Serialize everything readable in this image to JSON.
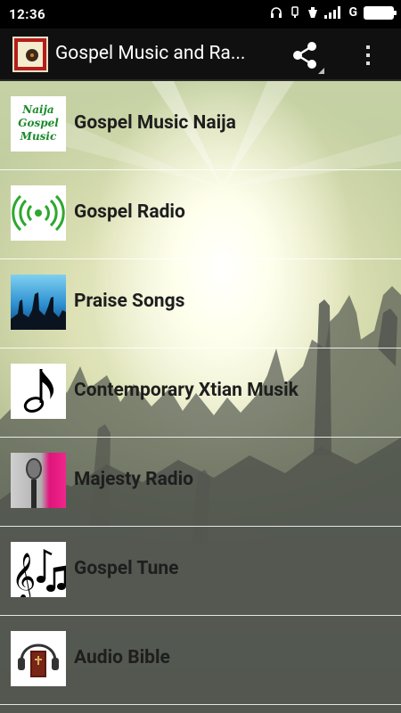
{
  "status_bar": {
    "time": "12:36",
    "network": "G"
  },
  "action_bar": {
    "title": "Gospel Music and Ra...",
    "share_icon": "share-icon",
    "overflow_icon": "overflow-menu-icon"
  },
  "list": {
    "items": [
      {
        "label": "Gospel Music Naija",
        "icon": "naija-gospel-music-logo"
      },
      {
        "label": "Gospel Radio",
        "icon": "radio-broadcast-icon"
      },
      {
        "label": "Praise Songs",
        "icon": "worship-crowd-thumbnail"
      },
      {
        "label": "Contemporary Xtian Musik",
        "icon": "music-note-icon"
      },
      {
        "label": "Majesty Radio",
        "icon": "microphone-thumbnail"
      },
      {
        "label": "Gospel Tune",
        "icon": "treble-clef-notes-icon"
      },
      {
        "label": "Audio Bible",
        "icon": "bible-headphones-thumbnail"
      }
    ],
    "logo_text": [
      "Naija",
      "Gospel",
      "Music"
    ]
  },
  "colors": {
    "status_bar_bg": "#000000",
    "action_bar_bg": "#101010",
    "radio_green": "#2ea82e",
    "label_text": "#1e1e1e"
  }
}
